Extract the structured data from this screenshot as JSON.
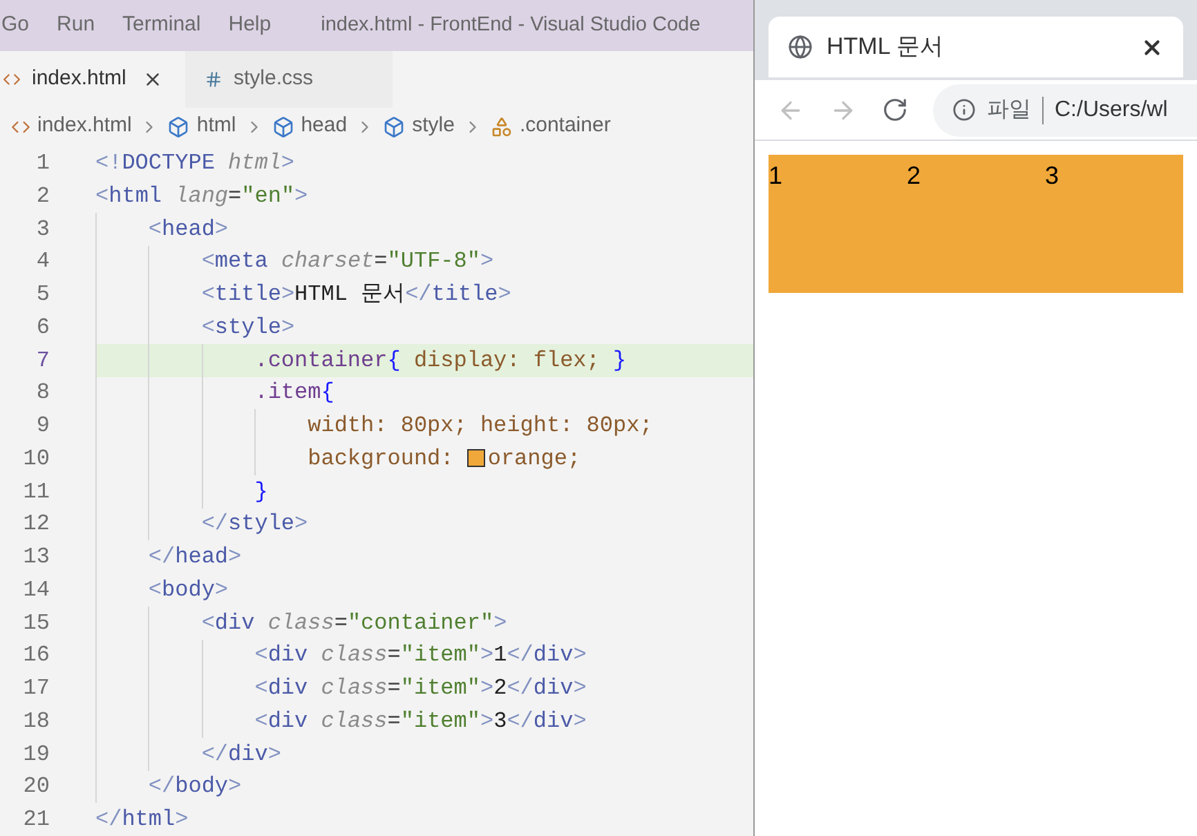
{
  "menu_bar": {
    "items": [
      "Go",
      "Run",
      "Terminal",
      "Help"
    ],
    "title": "index.html - FrontEnd - Visual Studio Code"
  },
  "editor_tabs": [
    {
      "label": "index.html",
      "kind": "html",
      "selected": true
    },
    {
      "label": "style.css",
      "kind": "css",
      "selected": false
    }
  ],
  "breadcrumbs": [
    {
      "label": "index.html",
      "kind": "file"
    },
    {
      "label": "html",
      "kind": "element"
    },
    {
      "label": "head",
      "kind": "element"
    },
    {
      "label": "style",
      "kind": "element"
    },
    {
      "label": ".container",
      "kind": "selector"
    }
  ],
  "editor": {
    "lines": [
      {
        "number": "1",
        "highlighted": false,
        "tokens": [
          {
            "kind": "punct",
            "text": "<!"
          },
          {
            "kind": "tag",
            "text": "DOCTYPE "
          },
          {
            "kind": "attr",
            "text": "html"
          },
          {
            "kind": "punct",
            "text": ">"
          }
        ]
      },
      {
        "number": "2",
        "highlighted": false,
        "tokens": [
          {
            "kind": "punct",
            "text": "<"
          },
          {
            "kind": "tag",
            "text": "html "
          },
          {
            "kind": "attr",
            "text": "lang"
          },
          {
            "kind": "plain",
            "text": "="
          },
          {
            "kind": "string",
            "text": "\"en\""
          },
          {
            "kind": "punct",
            "text": ">"
          }
        ]
      },
      {
        "number": "3",
        "highlighted": false,
        "tokens": [
          {
            "kind": "punct",
            "text": "    <"
          },
          {
            "kind": "tag",
            "text": "head"
          },
          {
            "kind": "punct",
            "text": ">"
          }
        ]
      },
      {
        "number": "4",
        "highlighted": false,
        "tokens": [
          {
            "kind": "punct",
            "text": "        <"
          },
          {
            "kind": "tag",
            "text": "meta "
          },
          {
            "kind": "attr",
            "text": "charset"
          },
          {
            "kind": "plain",
            "text": "="
          },
          {
            "kind": "string",
            "text": "\"UTF-8\""
          },
          {
            "kind": "punct",
            "text": ">"
          }
        ]
      },
      {
        "number": "5",
        "highlighted": false,
        "tokens": [
          {
            "kind": "punct",
            "text": "        <"
          },
          {
            "kind": "tag",
            "text": "title"
          },
          {
            "kind": "punct",
            "text": ">"
          },
          {
            "kind": "text",
            "text": "HTML 문서"
          },
          {
            "kind": "punct",
            "text": "</"
          },
          {
            "kind": "tag",
            "text": "title"
          },
          {
            "kind": "punct",
            "text": ">"
          }
        ]
      },
      {
        "number": "6",
        "highlighted": false,
        "tokens": [
          {
            "kind": "punct",
            "text": "        <"
          },
          {
            "kind": "tag",
            "text": "style"
          },
          {
            "kind": "punct",
            "text": ">"
          }
        ]
      },
      {
        "number": "7",
        "highlighted": true,
        "tokens": [
          {
            "kind": "selector",
            "text": "            .container"
          },
          {
            "kind": "brace",
            "text": "{"
          },
          {
            "kind": "property",
            "text": " display: flex; "
          },
          {
            "kind": "brace",
            "text": "}"
          }
        ]
      },
      {
        "number": "8",
        "highlighted": false,
        "tokens": [
          {
            "kind": "selector",
            "text": "            .item"
          },
          {
            "kind": "brace",
            "text": "{"
          }
        ]
      },
      {
        "number": "9",
        "highlighted": false,
        "tokens": [
          {
            "kind": "property",
            "text": "                width: 80px; height: 80px;"
          }
        ]
      },
      {
        "number": "10",
        "highlighted": false,
        "tokens": [
          {
            "kind": "property",
            "text": "                background: "
          },
          {
            "kind": "swatch",
            "color": "#f0a83a"
          },
          {
            "kind": "property",
            "text": "orange;"
          }
        ]
      },
      {
        "number": "11",
        "highlighted": false,
        "tokens": [
          {
            "kind": "brace",
            "text": "            }"
          }
        ]
      },
      {
        "number": "12",
        "highlighted": false,
        "tokens": [
          {
            "kind": "punct",
            "text": "        </"
          },
          {
            "kind": "tag",
            "text": "style"
          },
          {
            "kind": "punct",
            "text": ">"
          }
        ]
      },
      {
        "number": "13",
        "highlighted": false,
        "tokens": [
          {
            "kind": "punct",
            "text": "    </"
          },
          {
            "kind": "tag",
            "text": "head"
          },
          {
            "kind": "punct",
            "text": ">"
          }
        ]
      },
      {
        "number": "14",
        "highlighted": false,
        "tokens": [
          {
            "kind": "punct",
            "text": "    <"
          },
          {
            "kind": "tag",
            "text": "body"
          },
          {
            "kind": "punct",
            "text": ">"
          }
        ]
      },
      {
        "number": "15",
        "highlighted": false,
        "tokens": [
          {
            "kind": "punct",
            "text": "        <"
          },
          {
            "kind": "tag",
            "text": "div "
          },
          {
            "kind": "attr",
            "text": "class"
          },
          {
            "kind": "plain",
            "text": "="
          },
          {
            "kind": "string",
            "text": "\"container\""
          },
          {
            "kind": "punct",
            "text": ">"
          }
        ]
      },
      {
        "number": "16",
        "highlighted": false,
        "tokens": [
          {
            "kind": "punct",
            "text": "            <"
          },
          {
            "kind": "tag",
            "text": "div "
          },
          {
            "kind": "attr",
            "text": "class"
          },
          {
            "kind": "plain",
            "text": "="
          },
          {
            "kind": "string",
            "text": "\"item\""
          },
          {
            "kind": "punct",
            "text": ">"
          },
          {
            "kind": "text",
            "text": "1"
          },
          {
            "kind": "punct",
            "text": "</"
          },
          {
            "kind": "tag",
            "text": "div"
          },
          {
            "kind": "punct",
            "text": ">"
          }
        ]
      },
      {
        "number": "17",
        "highlighted": false,
        "tokens": [
          {
            "kind": "punct",
            "text": "            <"
          },
          {
            "kind": "tag",
            "text": "div "
          },
          {
            "kind": "attr",
            "text": "class"
          },
          {
            "kind": "plain",
            "text": "="
          },
          {
            "kind": "string",
            "text": "\"item\""
          },
          {
            "kind": "punct",
            "text": ">"
          },
          {
            "kind": "text",
            "text": "2"
          },
          {
            "kind": "punct",
            "text": "</"
          },
          {
            "kind": "tag",
            "text": "div"
          },
          {
            "kind": "punct",
            "text": ">"
          }
        ]
      },
      {
        "number": "18",
        "highlighted": false,
        "tokens": [
          {
            "kind": "punct",
            "text": "            <"
          },
          {
            "kind": "tag",
            "text": "div "
          },
          {
            "kind": "attr",
            "text": "class"
          },
          {
            "kind": "plain",
            "text": "="
          },
          {
            "kind": "string",
            "text": "\"item\""
          },
          {
            "kind": "punct",
            "text": ">"
          },
          {
            "kind": "text",
            "text": "3"
          },
          {
            "kind": "punct",
            "text": "</"
          },
          {
            "kind": "tag",
            "text": "div"
          },
          {
            "kind": "punct",
            "text": ">"
          }
        ]
      },
      {
        "number": "19",
        "highlighted": false,
        "tokens": [
          {
            "kind": "punct",
            "text": "        </"
          },
          {
            "kind": "tag",
            "text": "div"
          },
          {
            "kind": "punct",
            "text": ">"
          }
        ]
      },
      {
        "number": "20",
        "highlighted": false,
        "tokens": [
          {
            "kind": "punct",
            "text": "    </"
          },
          {
            "kind": "tag",
            "text": "body"
          },
          {
            "kind": "punct",
            "text": ">"
          }
        ]
      },
      {
        "number": "21",
        "highlighted": false,
        "tokens": [
          {
            "kind": "punct",
            "text": "</"
          },
          {
            "kind": "tag",
            "text": "html"
          },
          {
            "kind": "punct",
            "text": ">"
          }
        ]
      }
    ]
  },
  "browser": {
    "tab_title": "HTML 문서",
    "back_enabled": false,
    "forward_enabled": false,
    "address_label": "파일",
    "address": "C:/Users/wl",
    "page_items": [
      "1",
      "2",
      "3"
    ]
  }
}
